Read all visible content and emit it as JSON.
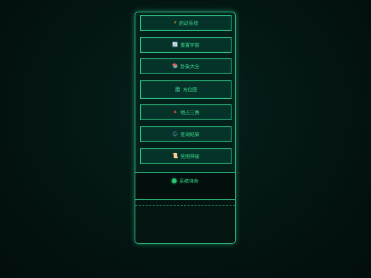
{
  "menu": {
    "items": [
      {
        "icon": "lightning-icon",
        "glyph": "⚡",
        "label": "启动系统"
      },
      {
        "icon": "refresh-icon",
        "glyph": "🔄",
        "label": "重置宇宙"
      },
      {
        "icon": "books-icon",
        "glyph": "📚",
        "label": "卦象大全"
      },
      {
        "icon": "classical-building-icon",
        "glyph": "🏛",
        "label": "方位图"
      },
      {
        "icon": "triangle-icon",
        "glyph": "🔺",
        "label": "地占三角"
      },
      {
        "icon": "scale-icon",
        "glyph": "⚖️",
        "label": "查询结果"
      },
      {
        "icon": "scroll-icon",
        "glyph": "📜",
        "label": "竞期神谕"
      }
    ]
  },
  "status": {
    "label": "系统待命",
    "color": "#28c76f"
  },
  "colors": {
    "accent": "#39d98f",
    "border": "#2bbf80",
    "background": "#031412"
  }
}
